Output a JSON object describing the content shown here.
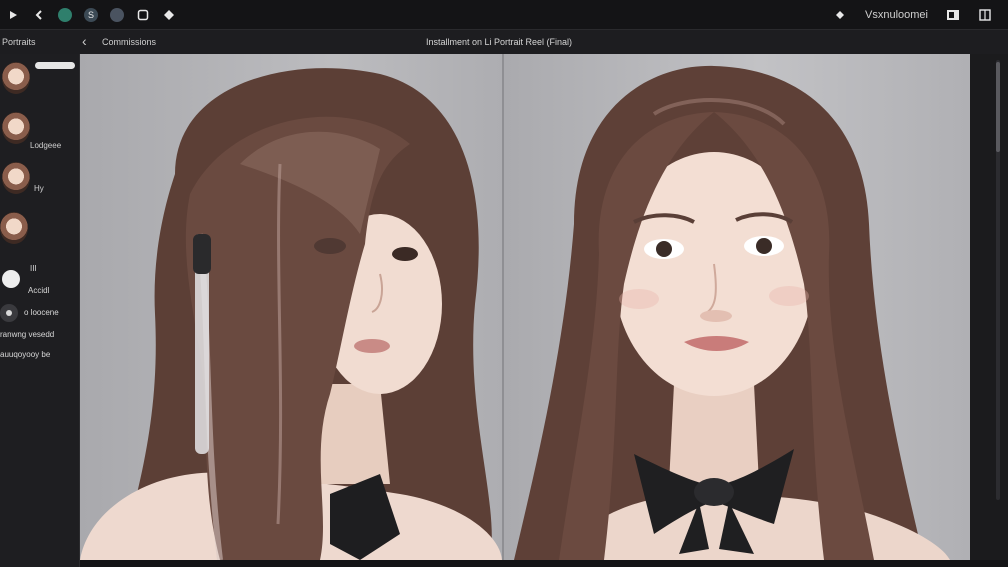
{
  "toolbar": {
    "left_icons": [
      "play-icon",
      "back-arrow-icon",
      "brush-icon",
      "s-tool-icon",
      "pen-icon",
      "square-icon",
      "tag-icon"
    ],
    "workspace_label": "Vsxnuloomei",
    "accent": "#2f7f6c"
  },
  "subheader": {
    "panel_title": "Portraits",
    "breadcrumb": "Commissions",
    "document_title": "Installment on Li Portrait Reel (Final)"
  },
  "sidebar": {
    "thumbnails": [
      {
        "label": ""
      },
      {
        "label": "Lodgeee"
      },
      {
        "label": "Hy"
      },
      {
        "label": ""
      }
    ],
    "items": [
      {
        "line1": "III",
        "line2": "Accidl"
      },
      {
        "line1": "o loocene"
      },
      {
        "line1": "ranwng vesedd"
      },
      {
        "line1": "auuqoyooy be"
      }
    ]
  },
  "canvas": {
    "photos": [
      "left-portrait",
      "right-portrait"
    ]
  }
}
